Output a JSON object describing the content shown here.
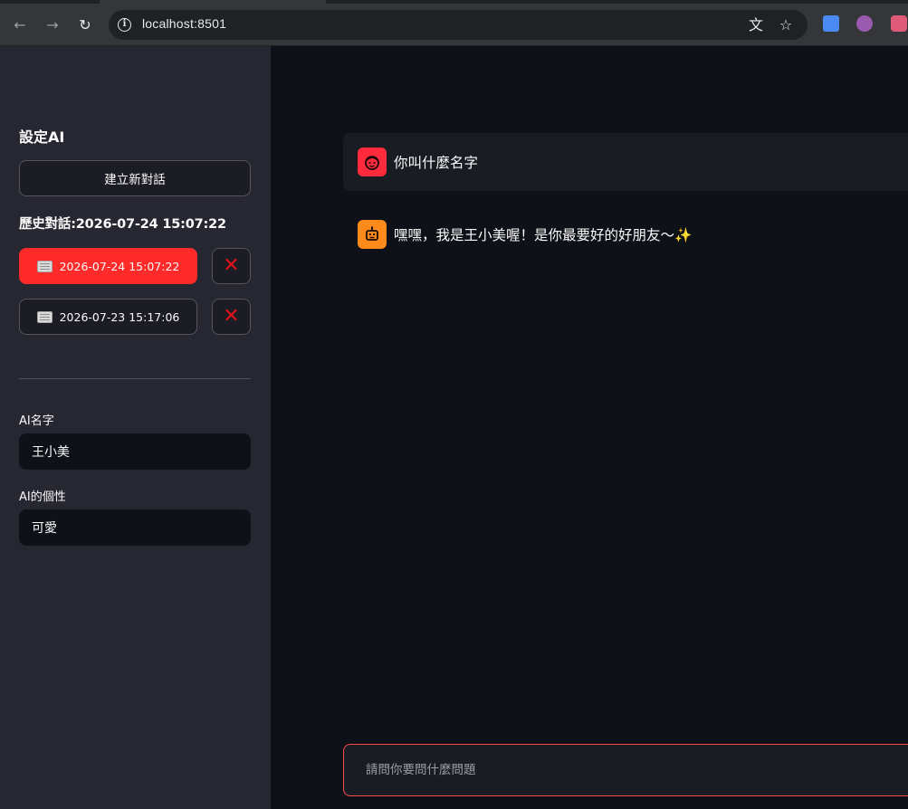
{
  "browser": {
    "url": "localhost:8501",
    "back_icon": "←",
    "forward_icon": "→",
    "reload_icon": "↻",
    "info_icon": "i",
    "translate_icon": "文",
    "star_icon": "☆"
  },
  "sidebar": {
    "title": "設定AI",
    "new_chat_label": "建立新對話",
    "history_label": "歷史對話:2026-07-24 15:07:22",
    "history_items": [
      {
        "label": "2026-07-24 15:07:22",
        "active": true
      },
      {
        "label": "2026-07-23 15:17:06",
        "active": false
      }
    ],
    "delete_icon": "✕",
    "fields": {
      "ai_name_label": "AI名字",
      "ai_name_value": "王小美",
      "ai_personality_label": "AI的個性",
      "ai_personality_value": "可愛"
    }
  },
  "chat": {
    "messages": [
      {
        "role": "user",
        "text": "你叫什麼名字"
      },
      {
        "role": "assistant",
        "text": "嘿嘿，我是王小美喔！是你最要好的好朋友～",
        "emoji": "✨"
      }
    ],
    "input_placeholder": "請問你要問什麼問題"
  },
  "colors": {
    "accent": "#ff2b2b",
    "user_avatar": "#ff2b3d",
    "assistant_avatar": "#ff8a1c",
    "sidebar_bg": "#262730",
    "main_bg": "#0e1117"
  }
}
